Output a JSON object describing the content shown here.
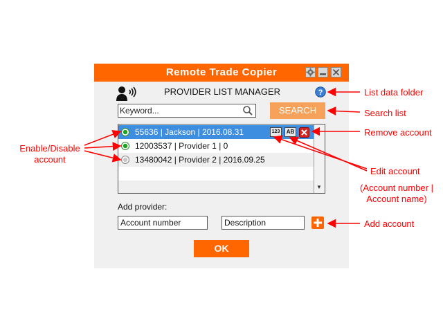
{
  "window": {
    "title": "Remote Trade Copier",
    "header_label": "PROVIDER LIST MANAGER",
    "accent_color": "#ff6600"
  },
  "titlebar_buttons": [
    "gear-icon",
    "minimize-icon",
    "close-icon"
  ],
  "search": {
    "placeholder": "Keyword...",
    "button_label": "SEARCH"
  },
  "providers": [
    {
      "text": "55636 | Jackson | 2016.08.31",
      "enabled": true,
      "selected": true,
      "badges": {
        "number": "123",
        "name": "AB"
      }
    },
    {
      "text": "12003537 | Provider 1 | 0",
      "enabled": true,
      "selected": false
    },
    {
      "text": "13480042 | Provider 2 | 2016.09.25",
      "enabled": false,
      "selected": false
    }
  ],
  "add_provider": {
    "label": "Add provider:",
    "account_placeholder": "Account number",
    "description_placeholder": "Description"
  },
  "ok_label": "OK",
  "annotations": {
    "list_data_folder": "List data folder",
    "search_list": "Search list",
    "remove_account": "Remove account",
    "enable_disable_line1": "Enable/Disable",
    "enable_disable_line2": "account",
    "edit_account": "Edit account",
    "edit_account_sub_line1": "(Account number |",
    "edit_account_sub_line2": "Account name)",
    "add_account": "Add account"
  }
}
